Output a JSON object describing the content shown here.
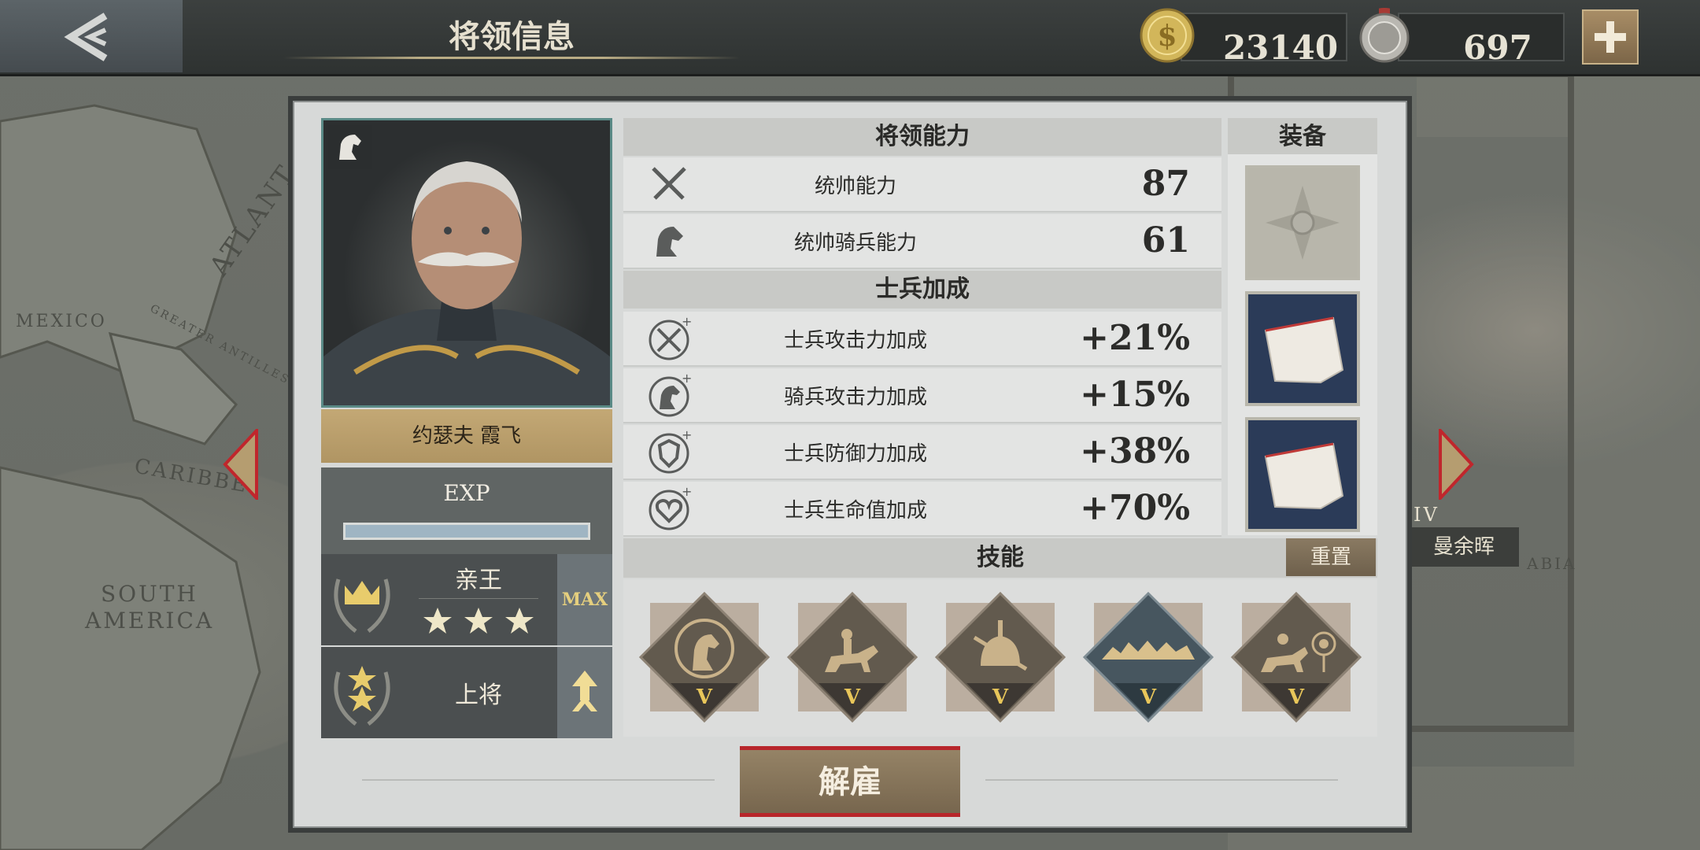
{
  "header": {
    "title": "将领信息",
    "gold_amount": "23140",
    "medal_amount": "697"
  },
  "general": {
    "name": "约瑟夫 霞飞",
    "exp_label": "EXP",
    "title_rank": "亲王",
    "title_max": "MAX",
    "military_rank": "上将",
    "stars": 3
  },
  "abilities": {
    "header": "将领能力",
    "rows": [
      {
        "label": "统帅能力",
        "value": "87"
      },
      {
        "label": "统帅骑兵能力",
        "value": "61"
      }
    ]
  },
  "soldier_bonus": {
    "header": "士兵加成",
    "rows": [
      {
        "label": "士兵攻击力加成",
        "value": "+21%"
      },
      {
        "label": "骑兵攻击力加成",
        "value": "+15%"
      },
      {
        "label": "士兵防御力加成",
        "value": "+38%"
      },
      {
        "label": "士兵生命值加成",
        "value": "+70%"
      }
    ]
  },
  "equipment": {
    "header": "装备"
  },
  "skills": {
    "header": "技能",
    "reset_label": "重置",
    "items": [
      {
        "level": "V",
        "icon": "cavalry-horse-head-icon"
      },
      {
        "level": "V",
        "icon": "mounted-rider-icon"
      },
      {
        "level": "V",
        "icon": "soldier-helmet-icon"
      },
      {
        "level": "V",
        "icon": "cavalry-charge-icon"
      },
      {
        "level": "V",
        "icon": "rider-target-icon"
      }
    ]
  },
  "actions": {
    "dismiss_label": "解雇"
  },
  "map": {
    "labels": [
      "MEXICO",
      "GREATER ANTILLES",
      "ATLANT",
      "CARIBBE",
      "SOUTH",
      "AMERICA",
      "ABIA",
      "IV"
    ],
    "side_label": "曼余晖"
  },
  "colors": {
    "accent_gold": "#c3a875",
    "panel_bg": "#d7d9d8",
    "dismiss_border": "#b8262b"
  }
}
